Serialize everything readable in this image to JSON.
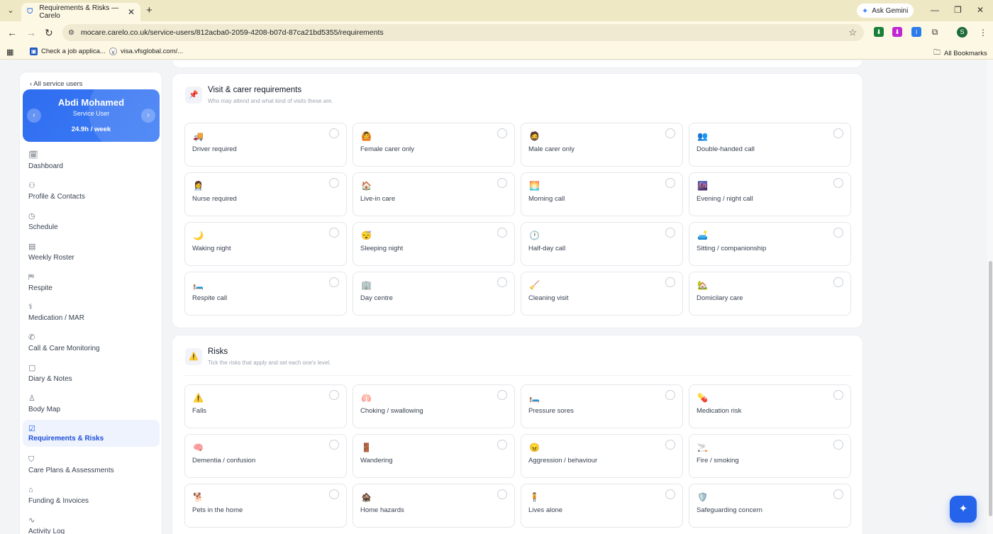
{
  "browser": {
    "tab_title": "Requirements & Risks — Carelo",
    "url": "mocare.carelo.co.uk/service-users/812acba0-2059-4208-b07d-87ca21bd5355/requirements",
    "gemini_label": "Ask Gemini",
    "profile_initial": "S",
    "bookmarks": [
      {
        "label": "Check a job applica..."
      },
      {
        "label": "visa.vfsglobal.com/..."
      }
    ],
    "all_bookmarks": "All Bookmarks"
  },
  "sidebar": {
    "back_label": "‹ All service users",
    "patient": {
      "name": "Abdi Mohamed",
      "role": "Service User",
      "hours": "24.9h / week"
    },
    "nav": [
      {
        "label": "Dashboard",
        "icon": "calendar-icon"
      },
      {
        "label": "Profile & Contacts",
        "icon": "person-icon"
      },
      {
        "label": "Schedule",
        "icon": "clock-icon"
      },
      {
        "label": "Weekly Roster",
        "icon": "roster-icon"
      },
      {
        "label": "Respite",
        "icon": "bed-icon"
      },
      {
        "label": "Medication / MAR",
        "icon": "pill-icon"
      },
      {
        "label": "Call & Care Monitoring",
        "icon": "phone-icon"
      },
      {
        "label": "Diary & Notes",
        "icon": "notes-icon"
      },
      {
        "label": "Body Map",
        "icon": "body-icon"
      },
      {
        "label": "Requirements & Risks",
        "icon": "checkbox-icon",
        "active": true
      },
      {
        "label": "Care Plans & Assessments",
        "icon": "shield-icon"
      },
      {
        "label": "Funding & Invoices",
        "icon": "bank-icon"
      },
      {
        "label": "Activity Log",
        "icon": "activity-icon"
      }
    ]
  },
  "visit": {
    "title": "Visit & carer requirements",
    "subtitle": "Who may attend and what kind of visits these are.",
    "icon": "📌",
    "items": [
      {
        "label": "Driver required",
        "icon": "🚚"
      },
      {
        "label": "Female carer only",
        "icon": "🙆"
      },
      {
        "label": "Male carer only",
        "icon": "🧔"
      },
      {
        "label": "Double-handed call",
        "icon": "👥"
      },
      {
        "label": "Nurse required",
        "icon": "👩‍⚕️"
      },
      {
        "label": "Live-in care",
        "icon": "🏠"
      },
      {
        "label": "Morning call",
        "icon": "🌅"
      },
      {
        "label": "Evening / night call",
        "icon": "🌆"
      },
      {
        "label": "Waking night",
        "icon": "🌙"
      },
      {
        "label": "Sleeping night",
        "icon": "😴"
      },
      {
        "label": "Half-day call",
        "icon": "🕐"
      },
      {
        "label": "Sitting / companionship",
        "icon": "🛋️"
      },
      {
        "label": "Respite call",
        "icon": "🛏️"
      },
      {
        "label": "Day centre",
        "icon": "🏢"
      },
      {
        "label": "Cleaning visit",
        "icon": "🧹"
      },
      {
        "label": "Domicilary care",
        "icon": "🏡"
      }
    ]
  },
  "risks": {
    "title": "Risks",
    "subtitle": "Tick the risks that apply and set each one's level.",
    "icon": "⚠️",
    "items": [
      {
        "label": "Falls",
        "icon": "⚠️"
      },
      {
        "label": "Choking / swallowing",
        "icon": "🫁"
      },
      {
        "label": "Pressure sores",
        "icon": "🛏️"
      },
      {
        "label": "Medication risk",
        "icon": "💊"
      },
      {
        "label": "Dementia / confusion",
        "icon": "🧠"
      },
      {
        "label": "Wandering",
        "icon": "🚪"
      },
      {
        "label": "Aggression / behaviour",
        "icon": "😠"
      },
      {
        "label": "Fire / smoking",
        "icon": "🚬"
      },
      {
        "label": "Pets in the home",
        "icon": "🐕"
      },
      {
        "label": "Home hazards",
        "icon": "🏚️"
      },
      {
        "label": "Lives alone",
        "icon": "🧍"
      },
      {
        "label": "Safeguarding concern",
        "icon": "🛡️"
      }
    ]
  },
  "colors": {
    "primary": "#2563eb",
    "chrome": "#fdf8e4"
  }
}
